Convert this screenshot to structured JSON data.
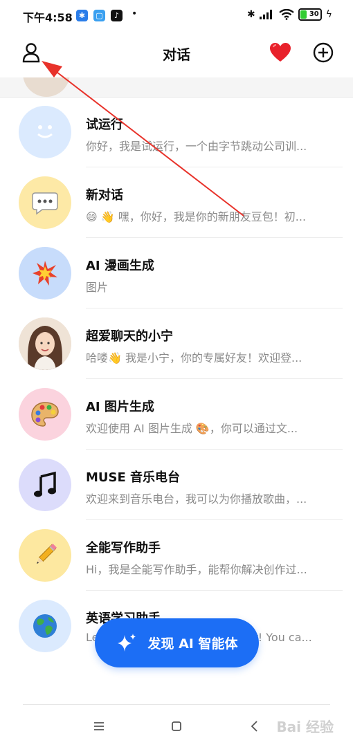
{
  "status_bar": {
    "time": "下午4:58",
    "battery": "30",
    "apps": [
      "bluetooth-app",
      "message-app",
      "tiktok-app"
    ]
  },
  "header": {
    "title": "对话"
  },
  "conversations": [
    {
      "title": "试运行",
      "preview": "你好，我是试运行，一个由字节跳动公司训...",
      "avatar": "face-icon",
      "avatar_color": "#dbeafe"
    },
    {
      "title": "新对话",
      "preview": "😄 👋 嘿，你好，我是你的新朋友豆包！初...",
      "avatar": "speech-bubble-icon",
      "avatar_color": "#fde9a6"
    },
    {
      "title": "AI 漫画生成",
      "preview": "图片",
      "avatar": "explosion-icon",
      "avatar_color": "#c7dcfb"
    },
    {
      "title": "超爱聊天的小宁",
      "preview": "哈喽👋 我是小宁，你的专属好友！欢迎登...",
      "avatar": "girl-portrait",
      "avatar_color": "#e7d6c6"
    },
    {
      "title": "AI 图片生成",
      "preview": "欢迎使用 AI 图片生成 🎨，你可以通过文...",
      "avatar": "palette-icon",
      "avatar_color": "#fbd3de"
    },
    {
      "title": "MUSE 音乐电台",
      "preview": "欢迎来到音乐电台，我可以为你播放歌曲，...",
      "avatar": "music-note-icon",
      "avatar_color": "#dcdcfb"
    },
    {
      "title": "全能写作助手",
      "preview": "Hi，我是全能写作助手，能帮你解决创作过...",
      "avatar": "pencil-icon",
      "avatar_color": "#fde8a0"
    },
    {
      "title": "英语学习助手",
      "preview": "Let me be your English partner! You ca...",
      "avatar": "globe-icon",
      "avatar_color": "#dbeafe"
    }
  ],
  "fab": {
    "label": "发现 AI 智能体"
  },
  "watermark": "Bai 经验"
}
